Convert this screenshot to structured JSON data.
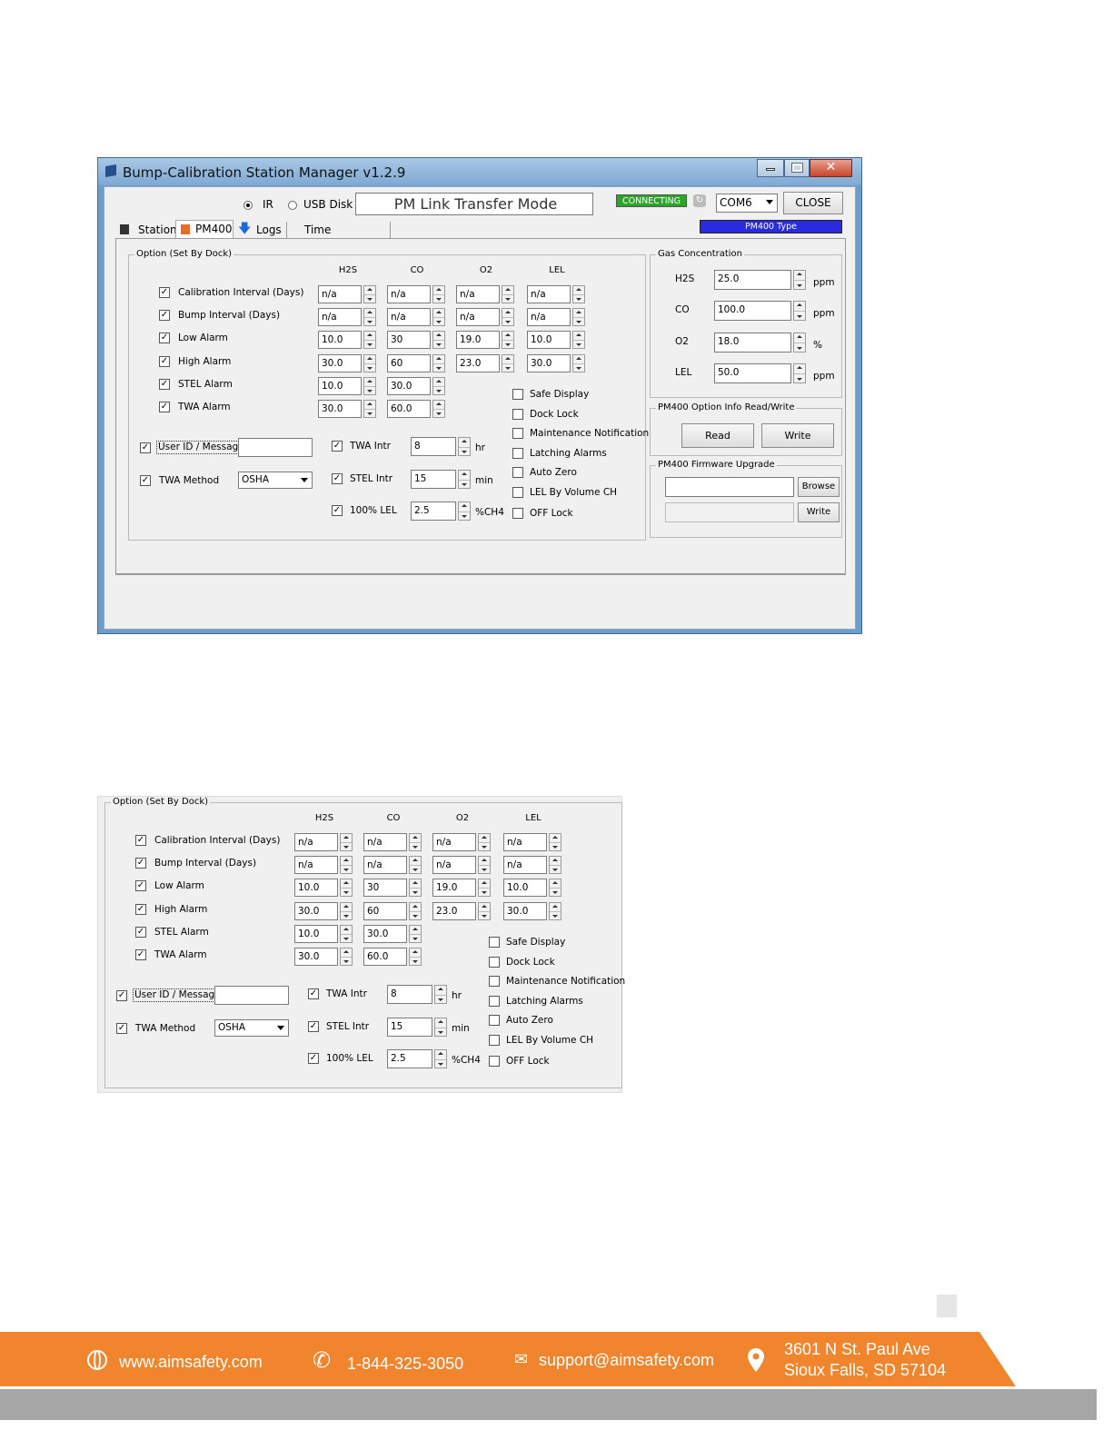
{
  "window": {
    "title": "Bump-Calibration Station Manager v1.2.9"
  },
  "toolbar": {
    "ir_label": "IR",
    "usb_label": "USB Disk",
    "mode_text": "PM Link Transfer Mode",
    "status_badge": "CONNECTING",
    "port_value": "COM6",
    "close_label": "CLOSE",
    "type_label": "PM400 Type"
  },
  "tabs": [
    "Station",
    "PM400",
    "Logs",
    "Time"
  ],
  "option": {
    "legend": "Option (Set By Dock)",
    "columns": [
      "H2S",
      "CO",
      "O2",
      "LEL"
    ],
    "rows": [
      {
        "label": "Calibration Interval (Days)",
        "values": [
          "n/a",
          "n/a",
          "n/a",
          "n/a"
        ]
      },
      {
        "label": "Bump Interval (Days)",
        "values": [
          "n/a",
          "n/a",
          "n/a",
          "n/a"
        ]
      },
      {
        "label": "Low Alarm",
        "values": [
          "10.0",
          "30",
          "19.0",
          "10.0"
        ]
      },
      {
        "label": "High Alarm",
        "values": [
          "30.0",
          "60",
          "23.0",
          "30.0"
        ]
      },
      {
        "label": "STEL Alarm",
        "values": [
          "10.0",
          "30.0"
        ]
      },
      {
        "label": "TWA Alarm",
        "values": [
          "30.0",
          "60.0"
        ]
      }
    ],
    "user_id_label": "User ID / Message",
    "user_id_value": "",
    "twa_method_label": "TWA Method",
    "twa_method_value": "OSHA",
    "twa_intr_label": "TWA Intr",
    "twa_intr_value": "8",
    "twa_intr_unit": "hr",
    "stel_intr_label": "STEL Intr",
    "stel_intr_value": "15",
    "stel_intr_unit": "min",
    "lel100_label": "100% LEL",
    "lel100_value": "2.5",
    "lel100_unit": "%CH4",
    "flags": [
      "Safe Display",
      "Dock Lock",
      "Maintenance Notification",
      "Latching Alarms",
      "Auto Zero",
      "LEL By Volume CH",
      "OFF Lock"
    ]
  },
  "gas": {
    "legend": "Gas Concentration",
    "items": [
      {
        "label": "H2S",
        "value": "25.0",
        "unit": "ppm"
      },
      {
        "label": "CO",
        "value": "100.0",
        "unit": "ppm"
      },
      {
        "label": "O2",
        "value": "18.0",
        "unit": "%"
      },
      {
        "label": "LEL",
        "value": "50.0",
        "unit": "ppm"
      }
    ]
  },
  "optinfo": {
    "legend": "PM400 Option Info Read/Write",
    "read_label": "Read",
    "write_label": "Write"
  },
  "firmware": {
    "legend": "PM400 Firmware Upgrade",
    "browse_label": "Browse",
    "write_label": "Write"
  },
  "footer": {
    "website": "www.aimsafety.com",
    "phone": "1-844-325-3050",
    "email": "support@aimsafety.com",
    "address_line1": "3601 N St. Paul Ave",
    "address_line2": "Sioux Falls, SD 57104"
  },
  "colors": {
    "accent_orange": "#f0852d",
    "status_green": "#2aa52a",
    "type_blue": "#2a2ae0",
    "footer_gray": "#a6a6a6"
  }
}
